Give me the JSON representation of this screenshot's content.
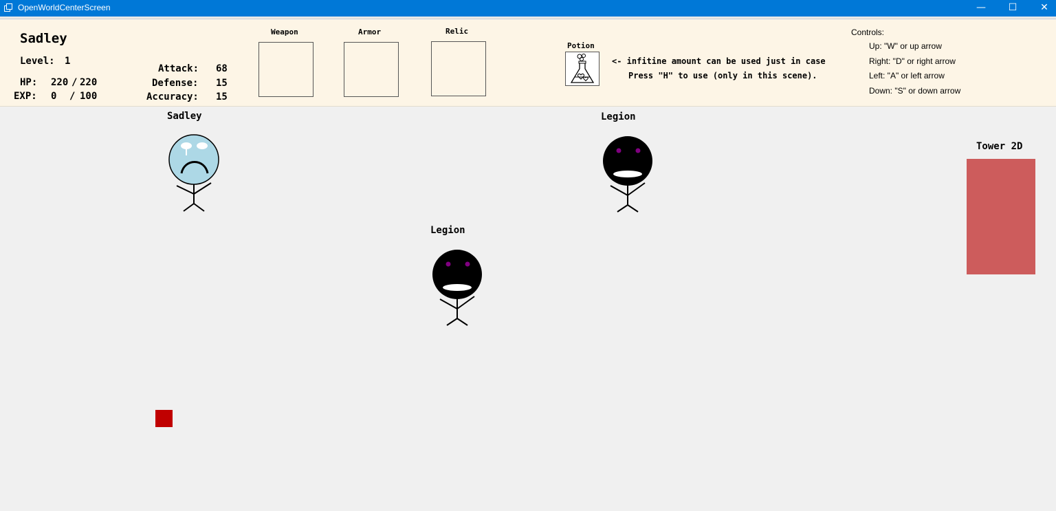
{
  "window": {
    "title": "OpenWorldCenterScreen",
    "minimize_glyph": "—",
    "maximize_glyph": "☐",
    "close_glyph": "✕"
  },
  "player": {
    "name": "Sadley",
    "level_label": "Level:",
    "level": "1",
    "hp_label": "HP:",
    "hp_current": "220",
    "hp_sep": "/",
    "hp_max": "220",
    "exp_label": "EXP:",
    "exp_current": "0",
    "exp_sep": "/",
    "exp_max": "100",
    "attack_label": "Attack:",
    "attack": "68",
    "defense_label": "Defense:",
    "defense": "15",
    "accuracy_label": "Accuracy:",
    "accuracy": "15"
  },
  "equipment": {
    "weapon_label": "Weapon",
    "armor_label": "Armor",
    "relic_label": "Relic",
    "potion_label": "Potion",
    "potion_icon": "potion-flask-icon"
  },
  "potion_note": {
    "line1": "<- infitine amount can be used just in case",
    "line2": "Press \"H\" to use (only in this scene)."
  },
  "controls": {
    "title": "Controls:",
    "up": "Up: \"W\" or up arrow",
    "right": "Right: \"D\" or right arrow",
    "left": "Left: \"A\" or left arrow",
    "down": "Down: \"S\" or down arrow"
  },
  "scene": {
    "hero_name": "Sadley",
    "enemy1_name": "Legion",
    "enemy2_name": "Legion",
    "tower_label": "Tower 2D",
    "colors": {
      "hero_face": "#add8e6",
      "enemy_face": "#000000",
      "enemy_eyes": "#800080",
      "tower": "#cd5c5c",
      "player_block": "#c00000",
      "panel_bg": "#fdf5e6",
      "titlebar": "#0078d7"
    }
  }
}
